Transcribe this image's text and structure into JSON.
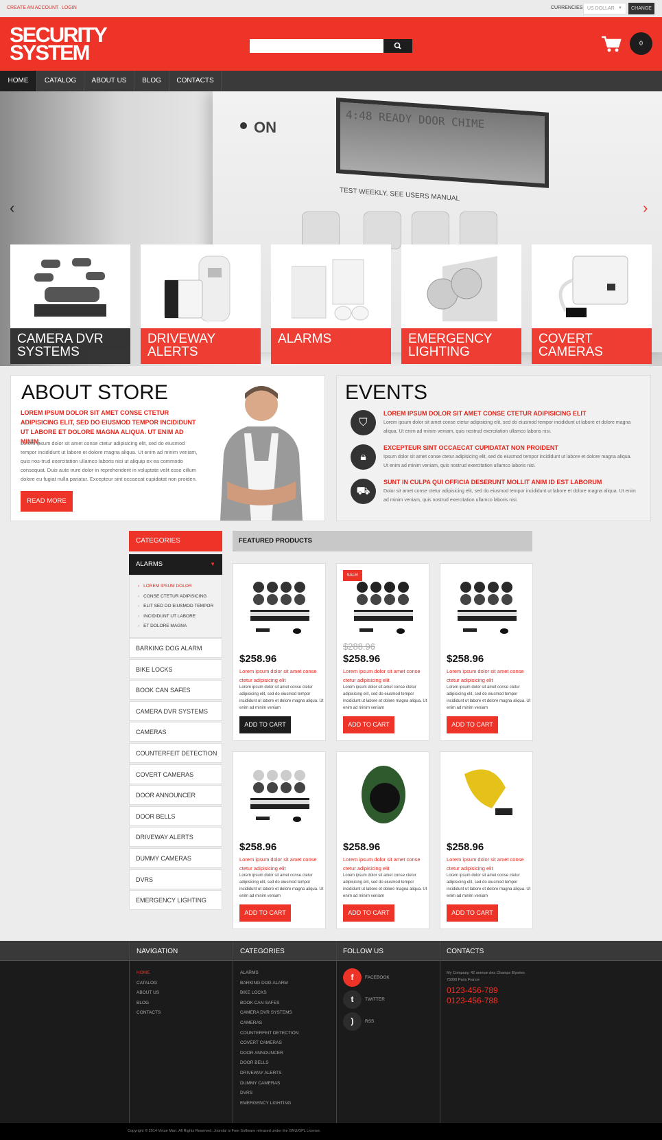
{
  "topbar": {
    "create_account": "CREATE AN ACCOUNT",
    "login": "LOGIN",
    "currencies_label": "CURRENCIES:",
    "currency_value": "US DOLLAR",
    "change_label": "CHANGE"
  },
  "header": {
    "logo_line1": "SECURITY",
    "logo_line2": "SYSTEM",
    "search_placeholder": "",
    "cart_count": "0"
  },
  "nav": [
    "HOME",
    "CATALOG",
    "ABOUT US",
    "BLOG",
    "CONTACTS"
  ],
  "hero": {
    "panel_text": "TEST WEEKLY. SEE USERS MANUAL",
    "on_label": "ON",
    "lcd_text": "4:48 READY DOOR CHIME"
  },
  "tiles": [
    {
      "label": "CAMERA DVR SYSTEMS"
    },
    {
      "label": "DRIVEWAY ALERTS"
    },
    {
      "label": "ALARMS"
    },
    {
      "label": "EMERGENCY LIGHTING"
    },
    {
      "label": "COVERT CAMERAS"
    }
  ],
  "about": {
    "title": "ABOUT STORE",
    "lead": "LOREM IPSUM DOLOR SIT AMET CONSE CTETUR ADIPISICING ELIT, SED DO EIUSMOD TEMPOR INCIDIDUNT UT LABORE ET DOLORE MAGNA ALIQUA. UT ENIM AD MINIM.",
    "body": "Lorem ipsum dolor sit amet conse ctetur adipisicing elit, sed do eiusmod tempor incididunt ut labore et dolore magna aliqua. Ut enim ad minim veniam, quis nos-trud exercitation ullamco laboris nisi ut aliquip ex ea commodo consequat. Duis aute irure dolor in reprehenderit in voluptate velit esse cillum dolore eu fugiat nulla pariatur. Excepteur sint occaecat cupidatat non proiden.",
    "button": "READ MORE"
  },
  "events": {
    "title": "EVENTS",
    "items": [
      {
        "icon": "shield-icon",
        "title": "LOREM IPSUM DOLOR SIT AMET CONSE CTETUR ADIPISICING ELIT",
        "text": "Lorem ipsum dolor sit amet conse ctetur adipisicing elit, sed do eiusmod tempor incididunt ut labore et dolore magna aliqua. Ut enim ad minim veniam, quis nostrud exercitation ullamco laboris nisi."
      },
      {
        "icon": "lock-icon",
        "title": "EXCEPTEUR SINT OCCAECAT CUPIDATAT NON PROIDENT",
        "text": "Ipsum dolor sit amet conse ctetur adipisicing elit, sed do eiusmod tempor incididunt ut labore et dolore magna aliqua. Ut enim ad minim veniam, quis nostrud exercitation ullamco laboris nisi."
      },
      {
        "icon": "truck-icon",
        "title": "SUNT IN CULPA QUI OFFICIA DESERUNT MOLLIT ANIM ID EST LABORUM",
        "text": "Dolor sit amet conse ctetur adipisicing elit, sed do eiusmod tempor incididunt ut labore et dolore magna aliqua. Ut enim ad minim veniam, quis nostrud exercitation ullamco laboris nisi."
      }
    ]
  },
  "sidebar": {
    "title": "CATEGORIES",
    "open_item": "ALARMS",
    "sub_items": [
      "LOREM IPSUM DOLOR",
      "CONSE CTETUR ADIPISICING",
      "ELIT SED DO EIUSMOD TEMPOR",
      "INCIDIDUNT UT LABORE",
      "ET DOLORE MAGNA"
    ],
    "items": [
      "BARKING DOG ALARM",
      "BIKE LOCKS",
      "BOOK CAN SAFES",
      "CAMERA DVR SYSTEMS",
      "CAMERAS",
      "COUNTERFEIT DETECTION",
      "COVERT CAMERAS",
      "DOOR ANNOUNCER",
      "DOOR BELLS",
      "DRIVEWAY ALERTS",
      "DUMMY CAMERAS",
      "DVRS",
      "EMERGENCY LIGHTING"
    ]
  },
  "featured": {
    "title": "FEATURED PRODUCTS",
    "products": [
      {
        "price": "$258.96",
        "old_price": "",
        "badge": "",
        "title": "Lorem ipsum dolor sit amet conse ctetur adipisicing elit",
        "desc": "Lorem ipsum dolor sit amet conse ctetur adipisicing elit, sed do eiusmod tempor incididunt ut labore et dolore magna aliqua. Ut enim ad minim veniam",
        "button": "ADD TO CART"
      },
      {
        "price": "$258.96",
        "old_price": "$288.96",
        "badge": "SALE!",
        "title": "Lorem ipsum dolor sit amet conse ctetur adipisicing elit",
        "desc": "Lorem ipsum dolor sit amet conse ctetur adipisicing elit, sed do eiusmod tempor incididunt ut labore et dolore magna aliqua. Ut enim ad minim veniam",
        "button": "ADD TO CART"
      },
      {
        "price": "$258.96",
        "old_price": "",
        "badge": "",
        "title": "Lorem ipsum dolor sit amet conse ctetur adipisicing elit",
        "desc": "Lorem ipsum dolor sit amet conse ctetur adipisicing elit, sed do eiusmod tempor incididunt ut labore et dolore magna aliqua. Ut enim ad minim veniam",
        "button": "ADD TO CART"
      },
      {
        "price": "$258.96",
        "old_price": "",
        "badge": "",
        "title": "Lorem ipsum dolor sit amet conse ctetur adipisicing elit",
        "desc": "Lorem ipsum dolor sit amet conse ctetur adipisicing elit, sed do eiusmod tempor incididunt ut labore et dolore magna aliqua. Ut enim ad minim veniam",
        "button": "ADD TO CART"
      },
      {
        "price": "$258.96",
        "old_price": "",
        "badge": "",
        "title": "Lorem ipsum dolor sit amet conse ctetur adipisicing elit",
        "desc": "Lorem ipsum dolor sit amet conse ctetur adipisicing elit, sed do eiusmod tempor incididunt ut labore et dolore magna aliqua. Ut enim ad minim veniam",
        "button": "ADD TO CART"
      },
      {
        "price": "$258.96",
        "old_price": "",
        "badge": "",
        "title": "Lorem ipsum dolor sit amet conse ctetur adipisicing elit",
        "desc": "Lorem ipsum dolor sit amet conse ctetur adipisicing elit, sed do eiusmod tempor incididunt ut labore et dolore magna aliqua. Ut enim ad minim veniam",
        "button": "ADD TO CART"
      }
    ]
  },
  "footer": {
    "nav_title": "NAVIGATION",
    "nav_items": [
      "HOME",
      "CATALOG",
      "ABOUT US",
      "BLOG",
      "CONTACTS"
    ],
    "cat_title": "CATEGORIES",
    "cat_items": [
      "ALARMS",
      "BARKING DOG ALARM",
      "BIKE LOCKS",
      "BOOK CAN SAFES",
      "CAMERA DVR SYSTEMS",
      "CAMERAS",
      "COUNTERFEIT DETECTION",
      "COVERT CAMERAS",
      "DOOR ANNOUNCER",
      "DOOR BELLS",
      "DRIVEWAY ALERTS",
      "DUMMY CAMERAS",
      "DVRS",
      "EMERGENCY LIGHTING"
    ],
    "follow_title": "FOLLOW US",
    "social": [
      {
        "icon": "facebook-icon",
        "label": "FACEBOOK"
      },
      {
        "icon": "twitter-icon",
        "label": "TWITTER"
      },
      {
        "icon": "rss-icon",
        "label": "RSS"
      }
    ],
    "contacts_title": "CONTACTS",
    "address1": "My Company, 42 avenue des Champs Elysées",
    "address2": "75000 Paris France",
    "phone1": "0123-456-789",
    "phone2": "0123-456-788",
    "copyright": "Copyright © 2014 Virtue Mart. All Rights Reserved. Joomla! is Free Software released under the GNU/GPL License."
  },
  "colors": {
    "accent": "#ee3328",
    "dark": "#1d1d1d",
    "nav": "#3a3a3a"
  }
}
